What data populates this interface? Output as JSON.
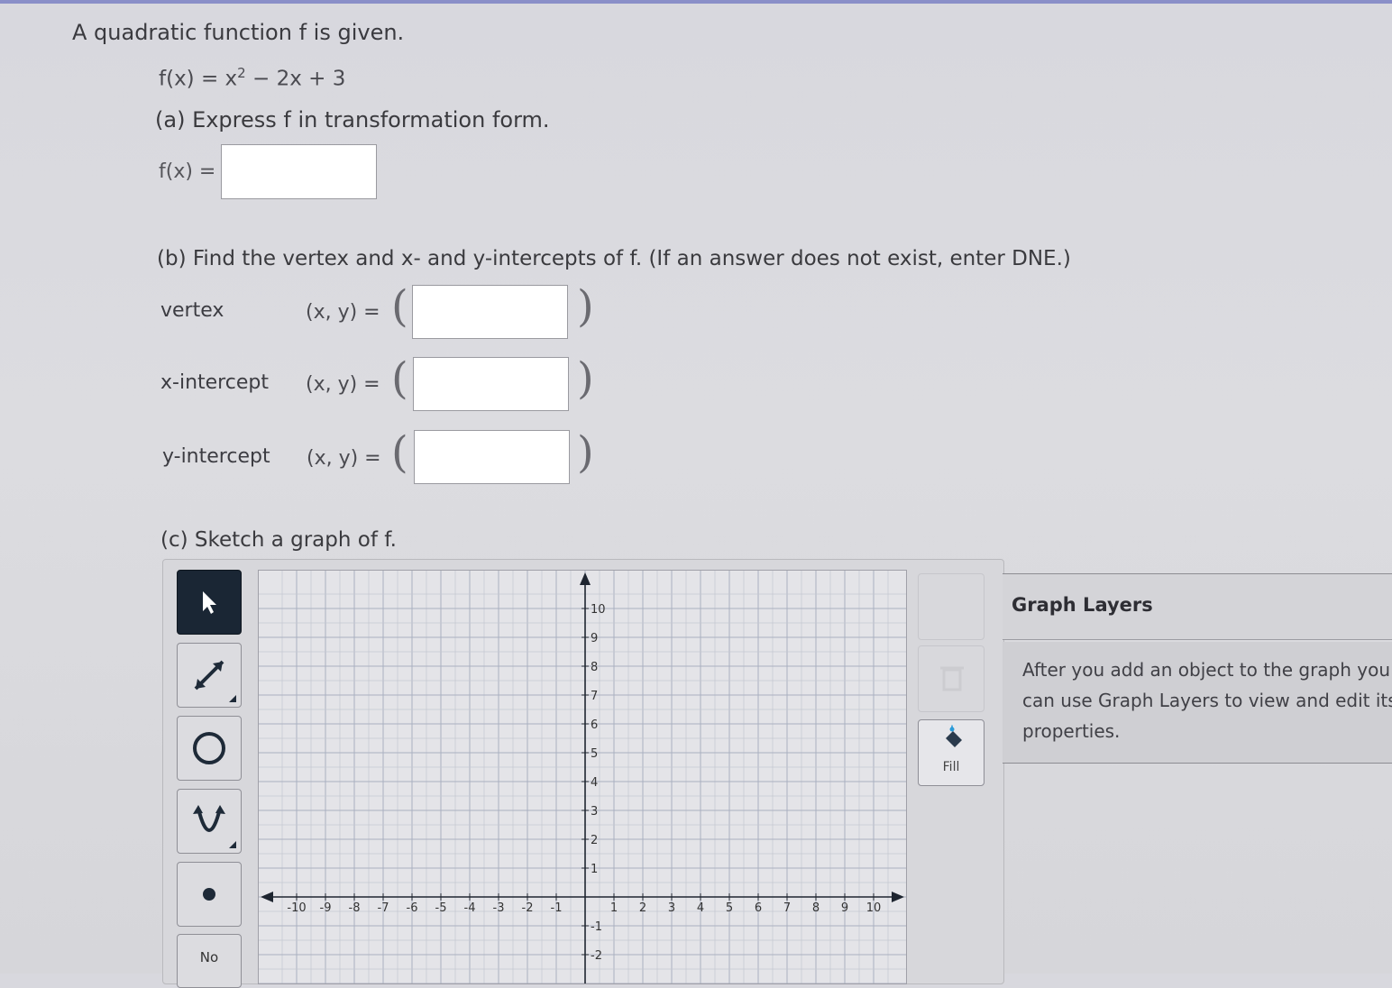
{
  "question": {
    "intro": "A quadratic function f is given.",
    "function_text": "f(x) = x",
    "exponent": "2",
    "function_tail": " − 2x + 3",
    "part_a": "(a) Express f in transformation form.",
    "part_a_label": "f(x) =",
    "part_b": "(b) Find the vertex and x- and y-intercepts of f. (If an answer does not exist, enter DNE.)",
    "rows": [
      {
        "label": "vertex",
        "xy": "(x, y) ="
      },
      {
        "label": "x-intercept",
        "xy": "(x, y) ="
      },
      {
        "label": "y-intercept",
        "xy": "(x, y) ="
      }
    ],
    "part_c": "(c) Sketch a graph of f.",
    "open_paren": "(",
    "close_paren": ")"
  },
  "tools": {
    "items": [
      {
        "name": "select-arrow-tool",
        "icon": "arrow-pointer-icon",
        "active": true
      },
      {
        "name": "line-tool",
        "icon": "double-arrow-line-icon",
        "active": false
      },
      {
        "name": "circle-tool",
        "icon": "circle-icon",
        "active": false
      },
      {
        "name": "parabola-tool",
        "icon": "parabola-icon",
        "active": false
      },
      {
        "name": "point-tool",
        "icon": "point-icon",
        "active": false
      }
    ],
    "no_solution_label": "No"
  },
  "graph": {
    "x_min": -10,
    "x_max": 10,
    "y_visible_min": -2,
    "y_max": 10,
    "x_tick_labels": [
      "-10",
      "-9",
      "-8",
      "-7",
      "-6",
      "-5",
      "-4",
      "-3",
      "-2",
      "-1",
      "1",
      "2",
      "3",
      "4",
      "5",
      "6",
      "7",
      "8",
      "9",
      "10"
    ],
    "y_tick_labels": [
      "10",
      "9",
      "8",
      "7",
      "6",
      "5",
      "4",
      "3",
      "2",
      "1",
      "-1",
      "-2"
    ]
  },
  "side": {
    "fill_label": "Fill"
  },
  "layers": {
    "title": "Graph Layers",
    "description": "After you add an object to the graph you can use Graph Layers to view and edit its properties."
  }
}
